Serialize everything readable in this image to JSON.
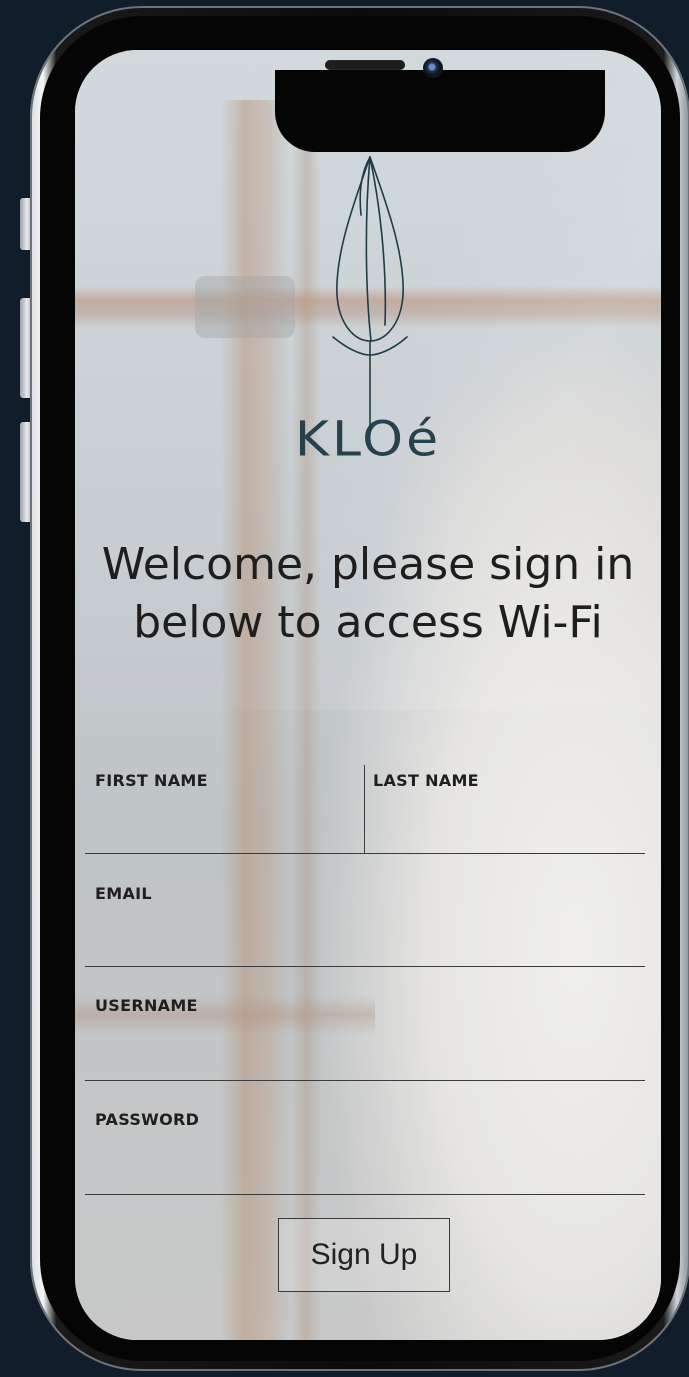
{
  "brand": {
    "name": "KLOé"
  },
  "welcome": {
    "text": "Welcome, please sign in below to access Wi-Fi"
  },
  "form": {
    "first_name": {
      "label": "FIRST NAME",
      "value": "",
      "placeholder": ""
    },
    "last_name": {
      "label": "LAST NAME",
      "value": "",
      "placeholder": ""
    },
    "email": {
      "label": "EMAIL",
      "value": "",
      "placeholder": ""
    },
    "username": {
      "label": "USERNAME",
      "value": "",
      "placeholder": ""
    },
    "password": {
      "label": "PASSWORD",
      "value": "",
      "placeholder": ""
    },
    "submit_label": "Sign Up"
  },
  "icons": {
    "logo": "leaf-logo-icon",
    "camera": "front-camera-icon",
    "speaker": "earpiece-speaker-icon"
  },
  "colors": {
    "brand": "#1f3b45",
    "page_background": "#111e2a",
    "text": "#1e1e1e"
  }
}
